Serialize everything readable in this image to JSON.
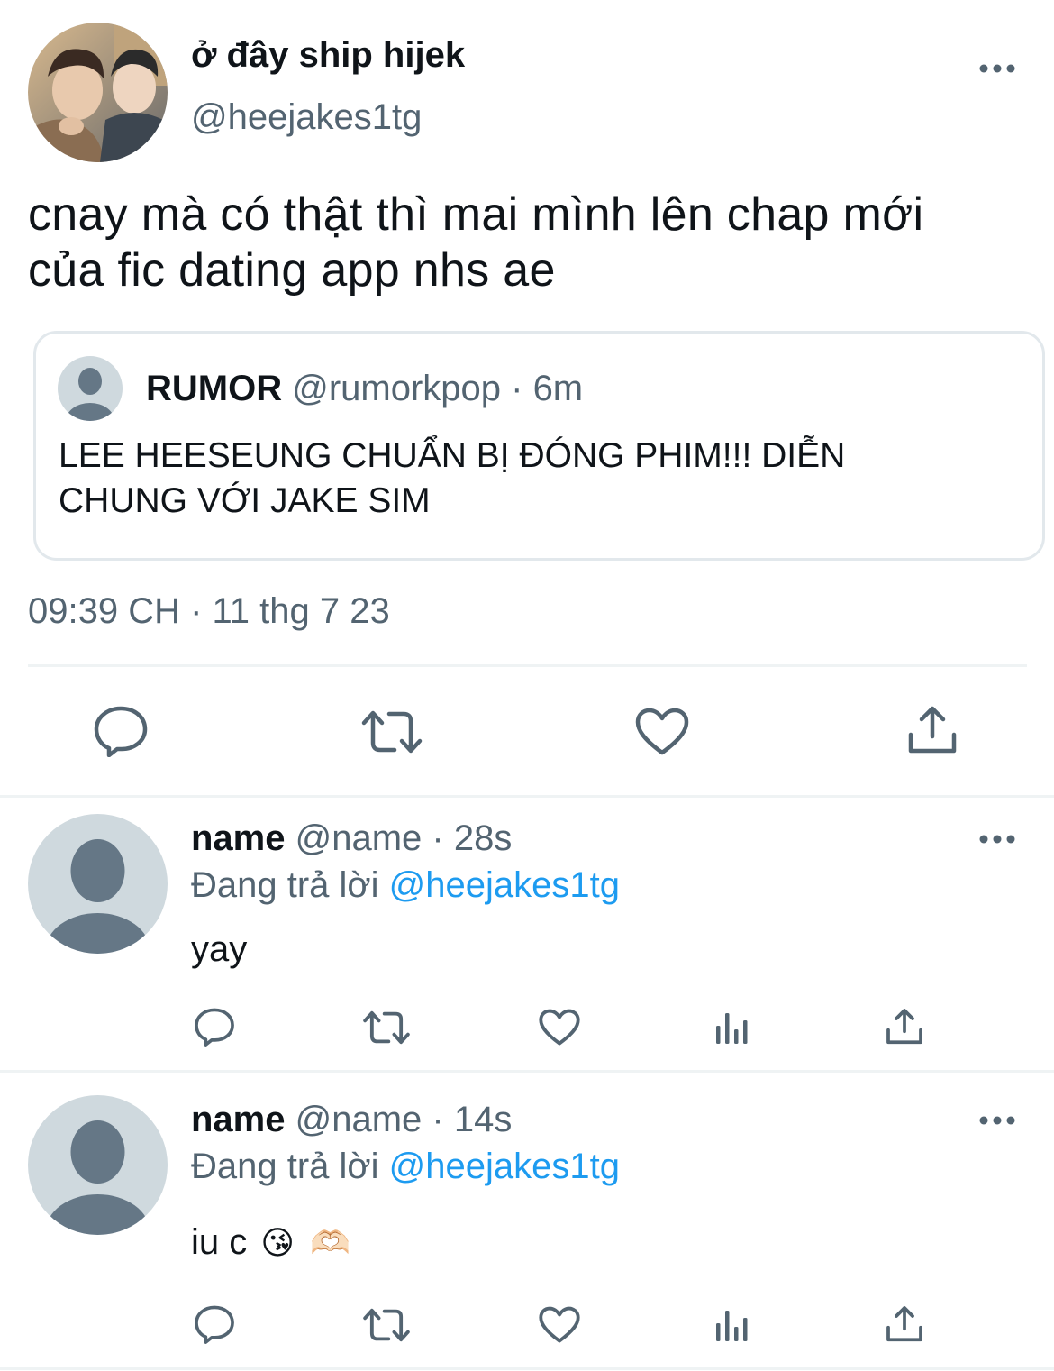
{
  "main_tweet": {
    "display_name": "ở đây ship hijek",
    "handle": "@heejakes1tg",
    "text_line1": "cnay mà có thật thì mai mình lên chap mới",
    "text_line2": "của fic dating app nhs ae",
    "timestamp": "09:39 CH · 11 thg 7 23",
    "quote": {
      "name": "RUMOR",
      "handle_time": "@rumorkpop · 6m",
      "text_line1": "LEE HEESEUNG CHUẨN BỊ ĐÓNG PHIM!!! DIỄN",
      "text_line2": "CHUNG VỚI JAKE SIM"
    }
  },
  "replies": [
    {
      "name": "name",
      "handle_time": "@name · 28s",
      "replying_prefix": "Đang trả lời",
      "replying_to": "@heejakes1tg",
      "text": "yay"
    },
    {
      "name": "name",
      "handle_time": "@name · 14s",
      "replying_prefix": "Đang trả lời",
      "replying_to": "@heejakes1tg",
      "text": "iu c",
      "emojis": [
        "😘",
        "🫶🏻"
      ]
    }
  ],
  "icons": {
    "more": "more-horizontal-icon",
    "reply": "reply-icon",
    "retweet": "retweet-icon",
    "like": "heart-icon",
    "views": "analytics-icon",
    "share": "share-icon"
  },
  "colors": {
    "text": "#0f1419",
    "secondary": "#536471",
    "link": "#1d9bf0",
    "placeholder_avatar_bg": "#cfd9de",
    "placeholder_avatar_fg": "#657786",
    "divider": "#eff3f4"
  }
}
